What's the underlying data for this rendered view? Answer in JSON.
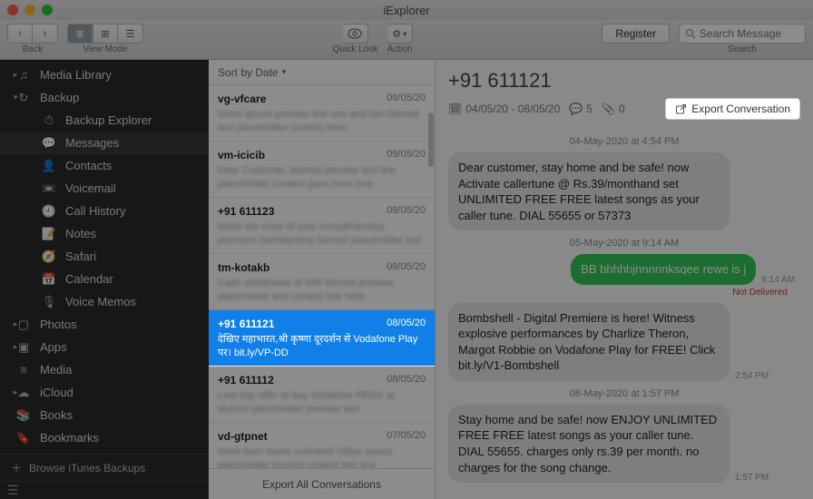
{
  "app_title": "iExplorer",
  "toolbar": {
    "back_label": "Back",
    "view_label": "View Mode",
    "quick_look_label": "Quick Look",
    "action_label": "Action",
    "register_label": "Register",
    "search_placeholder": "Search Message",
    "search_label": "Search"
  },
  "sidebar": {
    "items": [
      {
        "icon": "media",
        "label": "Media Library",
        "expandable": true
      },
      {
        "icon": "backup",
        "label": "Backup",
        "expandable": true,
        "expanded": true
      },
      {
        "icon": "explorer",
        "label": "Backup Explorer",
        "sub": true
      },
      {
        "icon": "messages",
        "label": "Messages",
        "sub": true,
        "active": true
      },
      {
        "icon": "contacts",
        "label": "Contacts",
        "sub": true
      },
      {
        "icon": "voicemail",
        "label": "Voicemail",
        "sub": true
      },
      {
        "icon": "history",
        "label": "Call History",
        "sub": true
      },
      {
        "icon": "notes",
        "label": "Notes",
        "sub": true
      },
      {
        "icon": "safari",
        "label": "Safari",
        "sub": true
      },
      {
        "icon": "calendar",
        "label": "Calendar",
        "sub": true
      },
      {
        "icon": "voicememo",
        "label": "Voice Memos",
        "sub": true
      },
      {
        "icon": "photos",
        "label": "Photos",
        "expandable": true
      },
      {
        "icon": "apps",
        "label": "Apps",
        "expandable": true
      },
      {
        "icon": "media2",
        "label": "Media"
      },
      {
        "icon": "icloud",
        "label": "iCloud",
        "expandable": true
      },
      {
        "icon": "books",
        "label": "Books"
      },
      {
        "icon": "bookmarks",
        "label": "Bookmarks"
      }
    ],
    "browse_label": "Browse iTunes Backups"
  },
  "convo": {
    "sort_label": "Sort by Date",
    "export_all_label": "Export All Conversations",
    "items": [
      {
        "name": "vg-vfcare",
        "date": "09/05/20",
        "preview": "lorem ipsum preview line one and two blurred text placeholder content here"
      },
      {
        "name": "vm-icicib",
        "date": "09/05/20",
        "preview": "Dear Customer, blurred preview text line placeholder content goes here now"
      },
      {
        "name": "+91 611123",
        "date": "09/05/20",
        "preview": "Make the most of your complimentary premium membership blurred placeholder text"
      },
      {
        "name": "tm-kotakb",
        "date": "09/05/20",
        "preview": "Cash withdrawal of INR blurred preview placeholder text content line here"
      },
      {
        "name": "+91 611121",
        "date": "08/05/20",
        "preview": "देखिए महाभारत,श्री कृष्णा दूरदर्शन से Vodafone Play पर। bit.ly/VP-DD",
        "selected": true
      },
      {
        "name": "+91 611112",
        "date": "08/05/20",
        "preview": "Last day offer to buy Vodafone REDX at blurred placeholder preview text"
      },
      {
        "name": "vd-gtpnet",
        "date": "07/05/20",
        "preview": "Work from home unlimited GBps speed placeholder blurred content text line"
      }
    ]
  },
  "detail": {
    "title": "+91 611121",
    "date_range": "04/05/20  -  08/05/20",
    "msg_count": "5",
    "attach_count": "0",
    "export_label": "Export Conversation",
    "days": [
      {
        "sep": "04-May-2020 at 4:54 PM",
        "msgs": [
          {
            "dir": "in",
            "text": "Dear customer, stay home and be safe! now Activate callertune @ Rs.39/monthand set UNLIMITED FREE FREE latest songs as your caller tune. DIAL 55655 or 57373",
            "ts": ""
          }
        ]
      },
      {
        "sep": "05-May-2020 at 9:14 AM",
        "msgs": [
          {
            "dir": "out",
            "text": "BB bhhhhjnnnnnksqee rewe is j",
            "ts": "9:14 AM",
            "not_delivered": true
          }
        ]
      },
      {
        "sep": "",
        "msgs": [
          {
            "dir": "in",
            "text": "Bombshell - Digital Premiere is here! Witness explosive performances by Charlize Theron, Margot Robbie on Vodafone Play for FREE! Click bit.ly/V1-Bombshell",
            "ts": "2:54 PM"
          }
        ]
      },
      {
        "sep": "08-May-2020 at 1:57 PM",
        "msgs": [
          {
            "dir": "in",
            "text": "Stay home and be safe! now ENJOY UNLIMITED FREE FREE latest songs as your caller tune. DIAL 55655. charges only rs.39 per month. no charges for the song change.",
            "ts": "1:57 PM"
          }
        ]
      }
    ],
    "not_delivered_label": "Not Delivered"
  }
}
